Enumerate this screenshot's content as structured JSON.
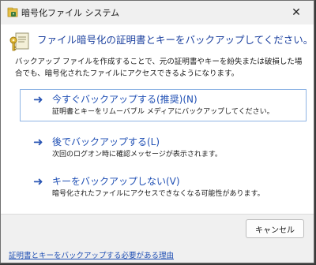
{
  "window": {
    "title": "暗号化ファイル システム",
    "close_glyph": "✕"
  },
  "header": {
    "heading": "ファイル暗号化の証明書とキーをバックアップしてください。",
    "description": "バックアップ ファイルを作成することで、元の証明書やキーを紛失または破損した場合でも、暗号化されたファイルにアクセスできるようになります。"
  },
  "options": [
    {
      "arrow": "➜",
      "title": "今すぐバックアップする(推奨)(N)",
      "subtitle": "証明書とキーをリムーバブル メディアにバックアップしてください。",
      "selected": true
    },
    {
      "arrow": "➜",
      "title": "後でバックアップする(L)",
      "subtitle": "次回のログオン時に確認メッセージが表示されます。",
      "selected": false
    },
    {
      "arrow": "➜",
      "title": "キーをバックアップしない(V)",
      "subtitle": "暗号化されたファイルにアクセスできなくなる可能性があります。",
      "selected": false
    }
  ],
  "footer": {
    "cancel_label": "キャンセル",
    "help_link": "証明書とキーをバックアップする必要がある理由"
  },
  "icons": {
    "window_icon": "encrypted-file-icon",
    "header_icon": "certificate-key-icon"
  },
  "colors": {
    "accent": "#1f4fb4",
    "heading": "#1a3f9e",
    "selected_border": "#8fb4e4"
  }
}
